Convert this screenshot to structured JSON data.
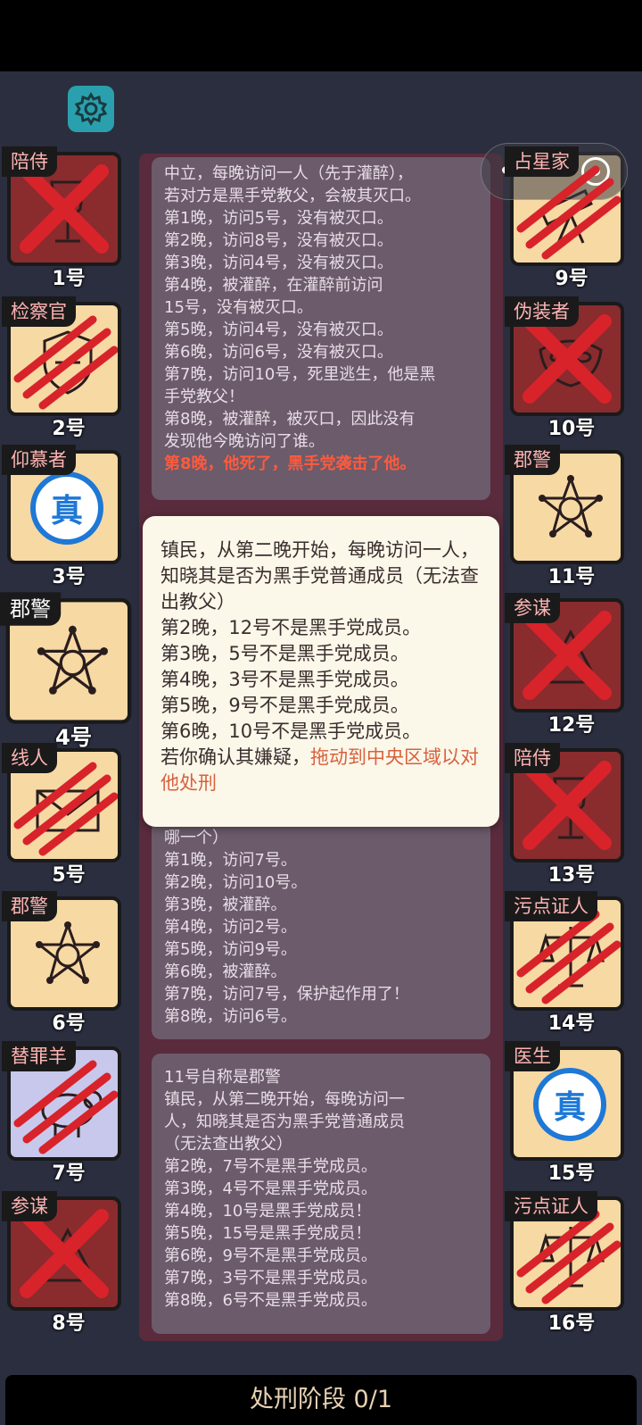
{
  "players_left": [
    {
      "number": "1号",
      "role": "陪侍",
      "dead": true,
      "mark": "x",
      "bg": "dark",
      "icon": "wine-glass-icon"
    },
    {
      "number": "2号",
      "role": "检察官",
      "dead": true,
      "mark": "claw",
      "bg": "light",
      "icon": "badge-icon"
    },
    {
      "number": "3号",
      "role": "仰慕者",
      "dead": false,
      "mark": "stamp",
      "bg": "light",
      "icon": "true-stamp-icon"
    },
    {
      "number": "4号",
      "role": "郡警",
      "dead": false,
      "mark": "none",
      "bg": "light",
      "icon": "sheriff-star-icon",
      "selected": true
    },
    {
      "number": "5号",
      "role": "线人",
      "dead": true,
      "mark": "claw",
      "bg": "light",
      "icon": "envelope-icon"
    },
    {
      "number": "6号",
      "role": "郡警",
      "dead": false,
      "mark": "none",
      "bg": "light",
      "icon": "sheriff-star-icon"
    },
    {
      "number": "7号",
      "role": "替罪羊",
      "dead": true,
      "mark": "claw",
      "bg": "lav",
      "icon": "sheep-icon"
    },
    {
      "number": "8号",
      "role": "参谋",
      "dead": true,
      "mark": "x",
      "bg": "dark",
      "icon": "advisor-icon"
    }
  ],
  "players_right": [
    {
      "number": "9号",
      "role": "占星家",
      "dead": true,
      "mark": "claw",
      "bg": "light",
      "icon": "telescope-icon"
    },
    {
      "number": "10号",
      "role": "伪装者",
      "dead": true,
      "mark": "x",
      "bg": "dark",
      "icon": "mask-icon"
    },
    {
      "number": "11号",
      "role": "郡警",
      "dead": false,
      "mark": "none",
      "bg": "light",
      "icon": "sheriff-star-icon"
    },
    {
      "number": "12号",
      "role": "参谋",
      "dead": true,
      "mark": "x",
      "bg": "dark",
      "icon": "advisor-icon"
    },
    {
      "number": "13号",
      "role": "陪侍",
      "dead": true,
      "mark": "x",
      "bg": "dark",
      "icon": "wine-glass-icon"
    },
    {
      "number": "14号",
      "role": "污点证人",
      "dead": true,
      "mark": "claw",
      "bg": "light",
      "icon": "scales-icon"
    },
    {
      "number": "15号",
      "role": "医生",
      "dead": false,
      "mark": "stamp",
      "bg": "light",
      "icon": "true-stamp-icon"
    },
    {
      "number": "16号",
      "role": "污点证人",
      "dead": true,
      "mark": "claw",
      "bg": "light",
      "icon": "scales-icon"
    }
  ],
  "stamp_text": "真",
  "log1": {
    "lines": [
      "中立，每晚访问一人（先于灌醉），",
      "若对方是黑手党教父，会被其灭口。",
      "第1晚，访问5号，没有被灭口。",
      "第2晚，访问8号，没有被灭口。",
      "第3晚，访问4号，没有被灭口。",
      "第4晚，被灌醉，在灌醉前访问",
      "15号，没有被灭口。",
      "第5晚，访问4号，没有被灭口。",
      "第6晚，访问6号，没有被灭口。",
      "第7晚，访问10号，死里逃生，他是黑",
      "手党教父！",
      "第8晚，被灌醉，被灭口，因此没有",
      "发现他今晚访问了谁。"
    ],
    "death": "第8晚，他死了，黑手党袭击了他。"
  },
  "log2": {
    "lines": [
      "哪一个）",
      "第1晚，访问7号。",
      "第2晚，访问10号。",
      "第3晚，被灌醉。",
      "第4晚，访问2号。",
      "第5晚，访问9号。",
      "第6晚，被灌醉。",
      "第7晚，访问7号，保护起作用了！",
      "第8晚，访问6号。"
    ]
  },
  "log3": {
    "lines": [
      "11号自称是郡警",
      "镇民，从第二晚开始，每晚访问一",
      "人，知晓其是否为黑手党普通成员",
      "（无法查出教父）",
      "第2晚，7号不是黑手党成员。",
      "第3晚，4号不是黑手党成员。",
      "第4晚，10号是黑手党成员！",
      "第5晚，15号是黑手党成员！",
      "第6晚，9号不是黑手党成员。",
      "第7晚，3号不是黑手党成员。",
      "第8晚，6号不是黑手党成员。"
    ]
  },
  "popup": {
    "body": "镇民，从第二晚开始，每晚访问一人，知晓其是否为黑手党普通成员（无法查出教父）\n第2晚，12号不是黑手党成员。\n第3晚，5号不是黑手党成员。\n第4晚，3号不是黑手党成员。\n第5晚，9号不是黑手党成员。\n第6晚，10号不是黑手党成员。\n若你确认其嫌疑，",
    "accent": "拖动到中央区域以对他处刑"
  },
  "status_bar": "处刑阶段 0/1",
  "colors": {
    "dead_bg": "#8a2b2e",
    "alive_bg": "#f7d9a4",
    "blood": "#d8232a",
    "stamp": "#1e78d6",
    "accent": "#d8613d"
  }
}
